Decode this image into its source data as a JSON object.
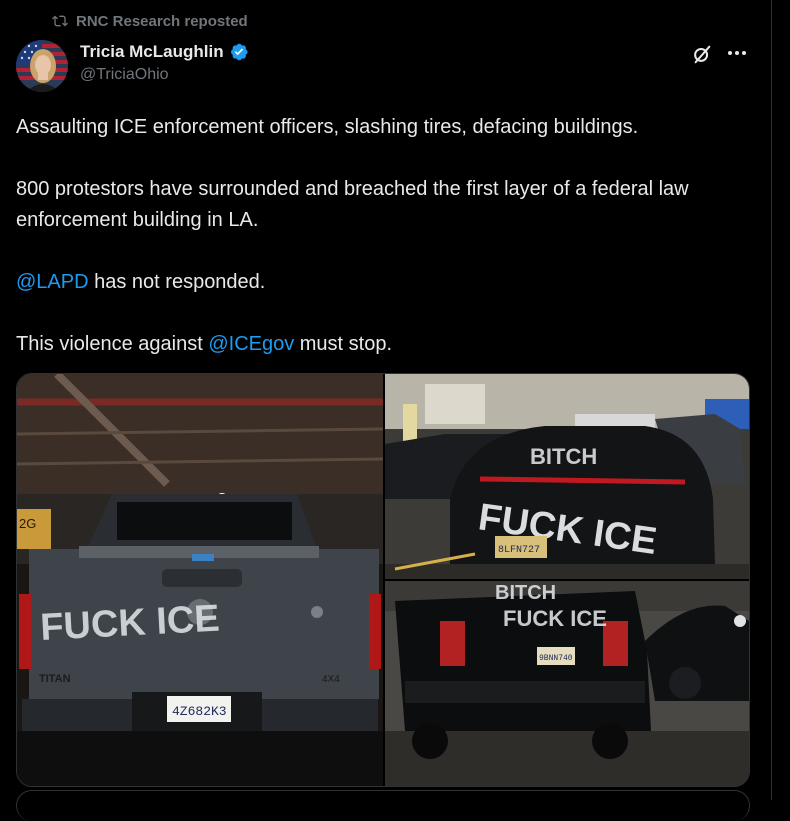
{
  "repost": {
    "label": "RNC Research reposted",
    "icon": "repost-icon"
  },
  "author": {
    "name": "Tricia McLaughlin",
    "handle": "@TriciaOhio",
    "verified": true,
    "verified_color": "#1d9bf0"
  },
  "actions": {
    "grok_icon": "grok-icon",
    "more_icon": "more-icon"
  },
  "tweet": {
    "line1": "Assaulting ICE enforcement officers, slashing tires, defacing buildings.",
    "line2": "800 protestors have surrounded and breached the first layer of a federal law enforcement building in LA.",
    "line3_mention": "@LAPD",
    "line3_rest": " has not responded.",
    "line4_start": "This violence against ",
    "line4_mention": "@ICEgov",
    "line4_end": " must stop."
  },
  "media": {
    "photo1": {
      "graffiti": "FUCK ICE",
      "badge": "TITAN",
      "trim": "4X4",
      "plate": "4Z682K3",
      "sign": "2G"
    },
    "photo2": {
      "graffiti_top": "BITCH",
      "graffiti": "FUCK ICE",
      "plate": "8LFN727"
    },
    "photo3": {
      "graffiti_top": "BITCH",
      "graffiti": "FUCK ICE",
      "plate": "9BNN740"
    }
  },
  "colors": {
    "link": "#1d9bf0",
    "muted": "#71767b",
    "text": "#e7e9ea",
    "background": "#000000"
  }
}
